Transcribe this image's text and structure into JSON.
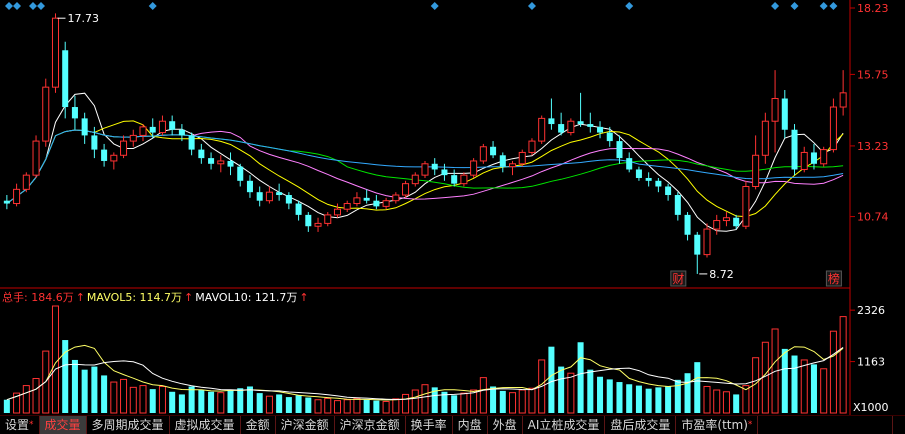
{
  "colors": {
    "up": "#ff3232",
    "down": "#54ffff",
    "ma5": "#ffffff",
    "ma10": "#ffff00",
    "ma20": "#ff80ff",
    "ma30": "#00e600",
    "ma60": "#33aaff",
    "axis": "#c00000",
    "price_label": "#ff3232",
    "vol_label": "#ffffff",
    "marker": "#3399dd",
    "badge_text": "#ff3232"
  },
  "price_axis": {
    "ticks": [
      "18.23",
      "15.75",
      "13.23",
      "10.74"
    ],
    "tick_values": [
      18.23,
      15.75,
      13.23,
      10.74
    ],
    "min": 8.4,
    "max": 18.23
  },
  "annotations": {
    "high_label": "17.73",
    "high_value": 17.73,
    "low_label": "8.72",
    "low_value": 8.72,
    "badge_cai": "财",
    "badge_bang": "榜"
  },
  "volume_axis": {
    "ticks": [
      "2326",
      "1163"
    ],
    "tick_values": [
      2326,
      1163
    ],
    "unit": "X1000",
    "max": 2420
  },
  "volume_legend": {
    "total": "总手: 184.6万",
    "ma5": "MAVOL5: 114.7万",
    "ma10": "MAVOL10: 121.7万"
  },
  "tabs": [
    {
      "label": "设置",
      "active": false,
      "star": true
    },
    {
      "label": "成交量",
      "active": true,
      "star": false
    },
    {
      "label": "多周期成交量",
      "active": false,
      "star": false
    },
    {
      "label": "虚拟成交量",
      "active": false,
      "star": false
    },
    {
      "label": "金额",
      "active": false,
      "star": false
    },
    {
      "label": "沪深金额",
      "active": false,
      "star": false
    },
    {
      "label": "沪深京金额",
      "active": false,
      "star": false
    },
    {
      "label": "换手率",
      "active": false,
      "star": false
    },
    {
      "label": "内盘",
      "active": false,
      "star": false
    },
    {
      "label": "外盘",
      "active": false,
      "star": false
    },
    {
      "label": "AI立桩成交量",
      "active": false,
      "star": false
    },
    {
      "label": "盘后成交量",
      "active": false,
      "star": false
    },
    {
      "label": "市盈率(ttm)",
      "active": false,
      "star": true
    }
  ],
  "chart_data": {
    "type": "candlestick",
    "candles": [
      [
        11.3,
        11.5,
        11.0,
        11.2
      ],
      [
        11.2,
        11.9,
        11.1,
        11.7
      ],
      [
        11.7,
        12.3,
        11.6,
        12.2
      ],
      [
        12.2,
        13.6,
        12.1,
        13.4
      ],
      [
        13.4,
        15.6,
        13.2,
        15.3
      ],
      [
        15.3,
        17.9,
        15.1,
        17.73
      ],
      [
        16.6,
        16.9,
        14.2,
        14.6
      ],
      [
        14.6,
        15.0,
        13.8,
        14.2
      ],
      [
        14.2,
        14.4,
        13.3,
        13.6
      ],
      [
        13.6,
        13.9,
        12.8,
        13.1
      ],
      [
        13.1,
        13.3,
        12.5,
        12.7
      ],
      [
        12.7,
        13.0,
        12.4,
        12.9
      ],
      [
        12.9,
        13.6,
        12.8,
        13.4
      ],
      [
        13.4,
        13.8,
        13.2,
        13.6
      ],
      [
        13.6,
        14.0,
        13.4,
        13.9
      ],
      [
        13.9,
        14.2,
        13.5,
        13.7
      ],
      [
        13.7,
        14.3,
        13.6,
        14.1
      ],
      [
        14.1,
        14.3,
        13.6,
        13.8
      ],
      [
        13.8,
        14.0,
        13.4,
        13.6
      ],
      [
        13.6,
        13.7,
        12.9,
        13.1
      ],
      [
        13.1,
        13.3,
        12.6,
        12.8
      ],
      [
        12.8,
        13.0,
        12.4,
        12.6
      ],
      [
        12.6,
        12.9,
        12.3,
        12.7
      ],
      [
        12.7,
        13.0,
        12.2,
        12.5
      ],
      [
        12.5,
        12.6,
        11.8,
        12.0
      ],
      [
        12.0,
        12.2,
        11.4,
        11.6
      ],
      [
        11.6,
        11.8,
        11.1,
        11.3
      ],
      [
        11.3,
        11.8,
        11.2,
        11.6
      ],
      [
        11.6,
        11.9,
        11.3,
        11.5
      ],
      [
        11.5,
        11.6,
        11.0,
        11.2
      ],
      [
        11.2,
        11.3,
        10.6,
        10.8
      ],
      [
        10.8,
        10.9,
        10.2,
        10.4
      ],
      [
        10.4,
        10.7,
        10.2,
        10.5
      ],
      [
        10.5,
        10.9,
        10.4,
        10.8
      ],
      [
        10.8,
        11.2,
        10.7,
        11.0
      ],
      [
        11.0,
        11.3,
        10.9,
        11.2
      ],
      [
        11.2,
        11.6,
        11.1,
        11.4
      ],
      [
        11.4,
        11.7,
        11.2,
        11.3
      ],
      [
        11.3,
        11.5,
        11.0,
        11.1
      ],
      [
        11.1,
        11.4,
        11.0,
        11.3
      ],
      [
        11.3,
        11.6,
        11.2,
        11.5
      ],
      [
        11.5,
        12.0,
        11.4,
        11.9
      ],
      [
        11.9,
        12.3,
        11.8,
        12.2
      ],
      [
        12.2,
        12.7,
        12.1,
        12.6
      ],
      [
        12.6,
        12.8,
        12.2,
        12.4
      ],
      [
        12.4,
        12.6,
        12.0,
        12.2
      ],
      [
        12.2,
        12.4,
        11.8,
        11.9
      ],
      [
        11.9,
        12.3,
        11.8,
        12.2
      ],
      [
        12.2,
        12.8,
        12.1,
        12.7
      ],
      [
        12.7,
        13.3,
        12.6,
        13.2
      ],
      [
        13.2,
        13.4,
        12.8,
        12.9
      ],
      [
        12.9,
        13.0,
        12.3,
        12.5
      ],
      [
        12.5,
        12.7,
        12.2,
        12.6
      ],
      [
        12.6,
        13.1,
        12.5,
        13.0
      ],
      [
        13.0,
        13.5,
        12.9,
        13.4
      ],
      [
        13.4,
        14.3,
        13.3,
        14.2
      ],
      [
        14.2,
        14.9,
        13.8,
        14.0
      ],
      [
        14.0,
        14.4,
        13.6,
        13.7
      ],
      [
        13.7,
        14.2,
        13.6,
        14.1
      ],
      [
        14.1,
        15.1,
        13.9,
        14.0
      ],
      [
        14.0,
        14.4,
        13.7,
        13.9
      ],
      [
        13.9,
        14.1,
        13.5,
        13.7
      ],
      [
        13.7,
        13.9,
        13.2,
        13.4
      ],
      [
        13.4,
        13.6,
        12.6,
        12.8
      ],
      [
        12.8,
        13.0,
        12.3,
        12.4
      ],
      [
        12.4,
        12.5,
        12.0,
        12.1
      ],
      [
        12.1,
        12.3,
        11.8,
        12.0
      ],
      [
        12.0,
        12.1,
        11.6,
        11.8
      ],
      [
        11.8,
        11.9,
        11.3,
        11.5
      ],
      [
        11.5,
        11.6,
        10.6,
        10.8
      ],
      [
        10.8,
        10.9,
        9.9,
        10.1
      ],
      [
        10.1,
        10.2,
        8.72,
        9.4
      ],
      [
        9.4,
        10.5,
        9.3,
        10.3
      ],
      [
        10.3,
        10.8,
        10.1,
        10.6
      ],
      [
        10.6,
        10.9,
        10.4,
        10.7
      ],
      [
        10.7,
        10.8,
        10.3,
        10.4
      ],
      [
        10.4,
        12.0,
        10.3,
        11.8
      ],
      [
        11.8,
        13.6,
        11.7,
        12.9
      ],
      [
        12.9,
        14.4,
        12.6,
        14.1
      ],
      [
        14.1,
        15.9,
        13.0,
        14.9
      ],
      [
        14.9,
        15.2,
        13.5,
        13.8
      ],
      [
        13.8,
        14.0,
        12.2,
        12.4
      ],
      [
        12.4,
        13.2,
        12.3,
        13.0
      ],
      [
        13.0,
        13.3,
        12.4,
        12.6
      ],
      [
        12.6,
        13.2,
        12.5,
        13.1
      ],
      [
        13.1,
        14.9,
        13.0,
        14.6
      ],
      [
        14.6,
        15.9,
        14.3,
        15.1
      ]
    ],
    "volume_thousands": [
      300,
      450,
      620,
      780,
      1400,
      2420,
      1650,
      1200,
      980,
      1050,
      850,
      700,
      760,
      580,
      620,
      540,
      600,
      480,
      420,
      600,
      520,
      480,
      460,
      520,
      560,
      600,
      450,
      380,
      420,
      360,
      400,
      350,
      300,
      330,
      280,
      300,
      330,
      300,
      280,
      260,
      320,
      420,
      520,
      640,
      580,
      480,
      400,
      450,
      520,
      800,
      600,
      500,
      460,
      520,
      560,
      1200,
      1500,
      1050,
      900,
      1600,
      980,
      820,
      760,
      700,
      650,
      620,
      550,
      580,
      600,
      750,
      900,
      1150,
      600,
      520,
      480,
      420,
      620,
      1250,
      1600,
      1900,
      1450,
      1300,
      1200,
      1100,
      1000,
      1850,
      2180
    ],
    "markers": {
      "top_diamonds_left_at_candle": [
        0,
        1,
        2,
        3,
        5
      ],
      "top_diamonds_right_at_candle": [
        15,
        44,
        54,
        64,
        79,
        81,
        84,
        85
      ]
    },
    "ma_periods": [
      5,
      10,
      20,
      30,
      60
    ],
    "vol_ma_periods": [
      5,
      10
    ],
    "ylim": [
      8.4,
      18.23
    ]
  }
}
